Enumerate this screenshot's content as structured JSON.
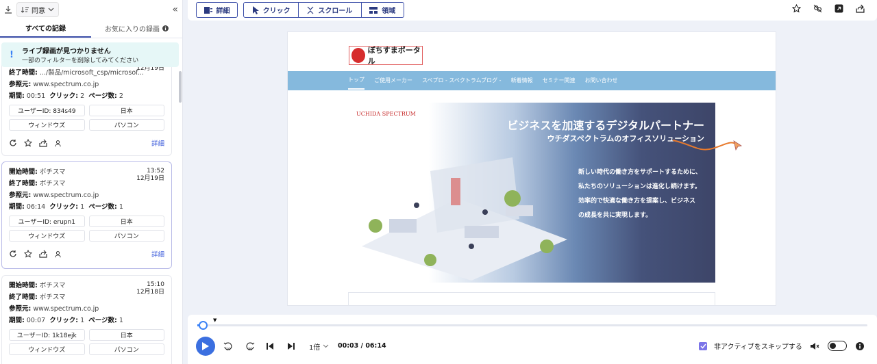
{
  "sidebar": {
    "sort_label": "同意",
    "tabs": [
      "すべての記録",
      "お気に入りの録画"
    ],
    "alert": {
      "title": "ライブ録画が見つかりません",
      "subtitle": "一部のフィルターを削除してみてください"
    },
    "labels": {
      "start": "開始時間:",
      "end": "終了時間:",
      "referrer": "参照元:",
      "duration": "期間:",
      "clicks": "クリック:",
      "pages": "ページ数:",
      "details": "詳細"
    },
    "cards": [
      {
        "time": "",
        "date": "12月19日",
        "start": "",
        "end": ".../製品/microsoft_csp/microsof...",
        "referrer": "www.spectrum.co.jp",
        "duration": "00:51",
        "clicks": "2",
        "pages": "2",
        "chips": [
          "ユーザーID: 834s49",
          "日本",
          "ウィンドウズ",
          "パソコン"
        ]
      },
      {
        "time": "13:52",
        "date": "12月19日",
        "start": "ボチスマ",
        "end": "ボチスマ",
        "referrer": "www.spectrum.co.jp",
        "duration": "06:14",
        "clicks": "1",
        "pages": "1",
        "chips": [
          "ユーザーID: erupn1",
          "日本",
          "ウィンドウズ",
          "パソコン"
        ]
      },
      {
        "time": "15:10",
        "date": "12月18日",
        "start": "ボチスマ",
        "end": "ボチスマ",
        "referrer": "www.spectrum.co.jp",
        "duration": "00:07",
        "clicks": "1",
        "pages": "1",
        "chips": [
          "ユーザーID: 1k18ejk",
          "日本",
          "ウィンドウズ",
          "パソコン"
        ]
      }
    ]
  },
  "toolbar": {
    "details": "詳細",
    "click": "クリック",
    "scroll": "スクロール",
    "area": "領域"
  },
  "site": {
    "logo_text": "ぼちすまポータル",
    "nav": [
      "トップ",
      "ご使用メーカー",
      "スペプロ - スペクトラムブログ -",
      "新着情報",
      "セミナー関連",
      "お問い合わせ"
    ],
    "brand": "UCHIDA SPECTRUM",
    "headline": "ビジネスを加速するデジタルパートナー",
    "subheadline": "ウチダスペクトラムのオフィスソリューション",
    "body": [
      "新しい時代の働き方をサポートするために、",
      "私たちのソリューションは進化し続けます。",
      "効率的で快適な働き方を提案し、ビジネス",
      "の成長を共に実現します。"
    ]
  },
  "player": {
    "progress": 0.008,
    "speed": "1倍",
    "time": "00:03 / 06:14",
    "skip_label": "非アクティブをスキップする",
    "skip_checked": true
  }
}
